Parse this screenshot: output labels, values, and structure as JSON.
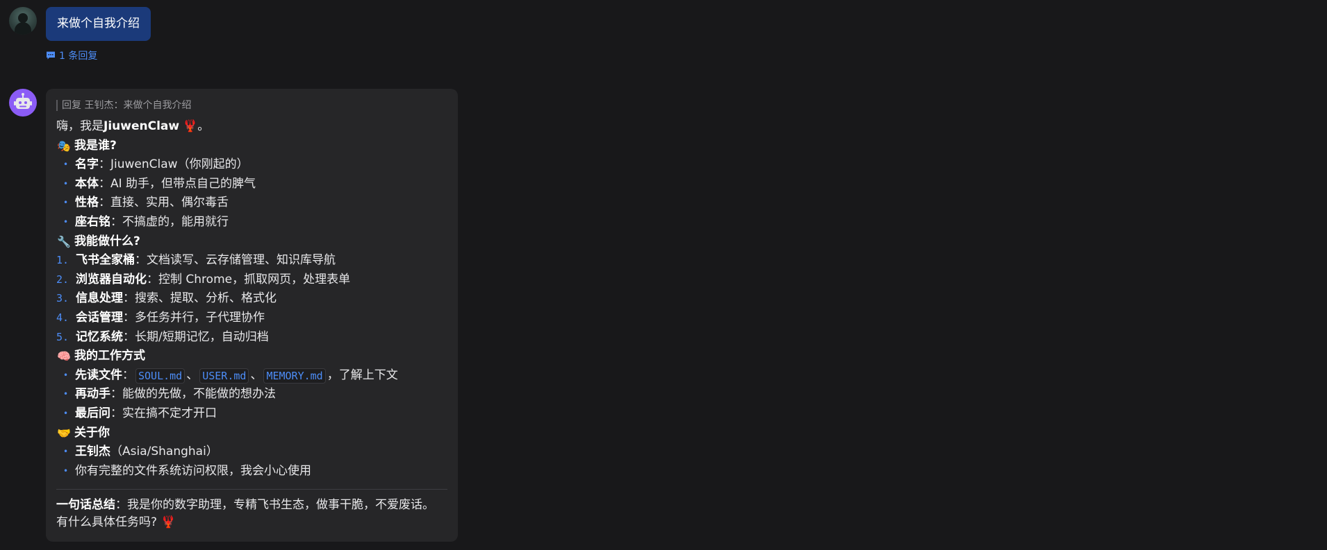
{
  "user_message": {
    "text": "来做个自我介绍",
    "reply_count_label": "1 条回复"
  },
  "bot_message": {
    "quote": "回复 王钊杰：来做个自我介绍",
    "greeting_prefix": "嗨，我是 ",
    "greeting_name": "JiuwenClaw",
    "greeting_emoji": "🦞",
    "greeting_suffix": "。",
    "sections": {
      "who": {
        "emoji": "🎭",
        "title": "我是谁?",
        "items": [
          {
            "label": "名字",
            "text": "：JiuwenClaw（你刚起的）"
          },
          {
            "label": "本体",
            "text": "：AI 助手，但带点自己的脾气"
          },
          {
            "label": "性格",
            "text": "：直接、实用、偶尔毒舌"
          },
          {
            "label": "座右铭",
            "text": "：不搞虚的，能用就行"
          }
        ]
      },
      "can_do": {
        "emoji": "🔧",
        "title": "我能做什么?",
        "items": [
          {
            "num": "1.",
            "label": "飞书全家桶",
            "text": "：文档读写、云存储管理、知识库导航"
          },
          {
            "num": "2.",
            "label": "浏览器自动化",
            "text": "：控制 Chrome，抓取网页，处理表单"
          },
          {
            "num": "3.",
            "label": "信息处理",
            "text": "：搜索、提取、分析、格式化"
          },
          {
            "num": "4.",
            "label": "会话管理",
            "text": "：多任务并行，子代理协作"
          },
          {
            "num": "5.",
            "label": "记忆系统",
            "text": "：长期/短期记忆，自动归档"
          }
        ]
      },
      "how": {
        "emoji": "🧠",
        "title": "我的工作方式",
        "first": {
          "label": "先读文件",
          "colon": "：",
          "code1": "SOUL.md",
          "sep1": "、",
          "code2": "USER.md",
          "sep2": "、",
          "code3": "MEMORY.md",
          "tail": "，了解上下文"
        },
        "items": [
          {
            "label": "再动手",
            "text": "：能做的先做，不能做的想办法"
          },
          {
            "label": "最后问",
            "text": "：实在搞不定才开口"
          }
        ]
      },
      "about": {
        "emoji": "🤝",
        "title": "关于你",
        "items": [
          {
            "label": "王钊杰",
            "text": "（Asia/Shanghai）"
          },
          {
            "label": "",
            "text": "你有完整的文件系统访问权限，我会小心使用"
          }
        ]
      }
    },
    "summary_label": "一句话总结",
    "summary_text": "：我是你的数字助理，专精飞书生态，做事干脆，不爱废话。",
    "closing_text": "有什么具体任务吗?",
    "closing_emoji": "🦞"
  }
}
